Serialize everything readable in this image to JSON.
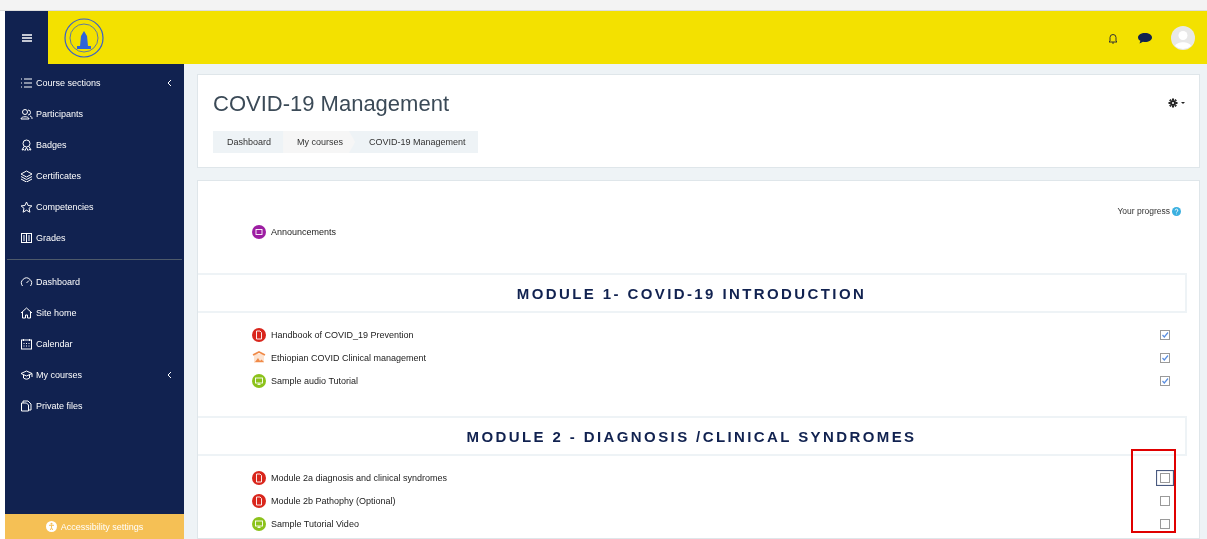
{
  "sidebar": {
    "groups": [
      [
        {
          "label": "Course sections",
          "expandable": true
        },
        {
          "label": "Participants",
          "expandable": false
        },
        {
          "label": "Badges",
          "expandable": false
        },
        {
          "label": "Certificates",
          "expandable": false
        },
        {
          "label": "Competencies",
          "expandable": false
        },
        {
          "label": "Grades",
          "expandable": false
        }
      ],
      [
        {
          "label": "Dashboard",
          "expandable": false
        },
        {
          "label": "Site home",
          "expandable": false
        },
        {
          "label": "Calendar",
          "expandable": false
        },
        {
          "label": "My courses",
          "expandable": true
        },
        {
          "label": "Private files",
          "expandable": false
        }
      ]
    ],
    "footer": "Accessibility settings"
  },
  "header": {
    "title": "COVID-19 Management",
    "breadcrumb": [
      "Dashboard",
      "My courses",
      "COVID-19 Management"
    ]
  },
  "progress_label": "Your progress",
  "intro": [
    {
      "kind": "forum",
      "name": "Announcements"
    }
  ],
  "sections": [
    {
      "title": "MODULE 1- COVID-19 INTRODUCTION",
      "highlighted": false,
      "activities": [
        {
          "kind": "pdf",
          "name": "Handbook of COVID_19 Prevention",
          "checked": true,
          "focused": false
        },
        {
          "kind": "image",
          "name": "Ethiopian COVID Clinical management",
          "checked": true,
          "focused": false
        },
        {
          "kind": "media",
          "name": "Sample audio Tutorial",
          "checked": true,
          "focused": false
        }
      ]
    },
    {
      "title": "MODULE 2 - DIAGNOSIS /CLINICAL SYNDROMES",
      "highlighted": true,
      "activities": [
        {
          "kind": "pdf",
          "name": "Module 2a diagnosis and clinical syndromes",
          "checked": false,
          "focused": true
        },
        {
          "kind": "pdf",
          "name": "Module 2b Pathophy (Optional)",
          "checked": false,
          "focused": false
        },
        {
          "kind": "media",
          "name": "Sample Tutorial Video",
          "checked": false,
          "focused": false
        }
      ]
    }
  ]
}
